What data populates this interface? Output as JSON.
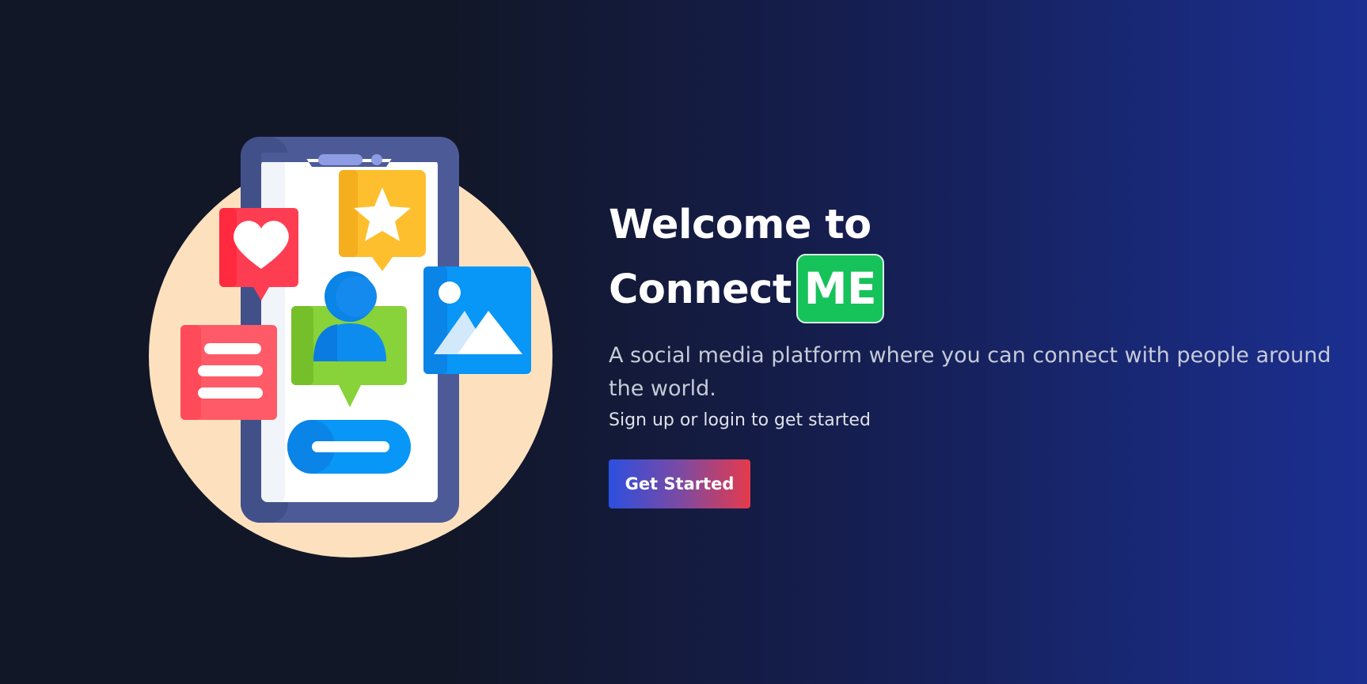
{
  "hero": {
    "title_line1": "Welcome to",
    "title_line2": "Connect",
    "brand_badge": "ME",
    "description": "A social media platform where you can connect with people around the world.",
    "subtext": "Sign up or login to get started",
    "cta_label": "Get Started"
  },
  "colors": {
    "background_start": "#121728",
    "background_end": "#1b2f91",
    "badge_green": "#16c25a",
    "cta_gradient_start": "#2c4fe0",
    "cta_gradient_end": "#e53a4c"
  },
  "illustration": {
    "icons": [
      "phone-icon",
      "heart-message-icon",
      "star-message-icon",
      "user-message-icon",
      "image-icon",
      "text-message-icon",
      "input-pill-icon"
    ]
  }
}
